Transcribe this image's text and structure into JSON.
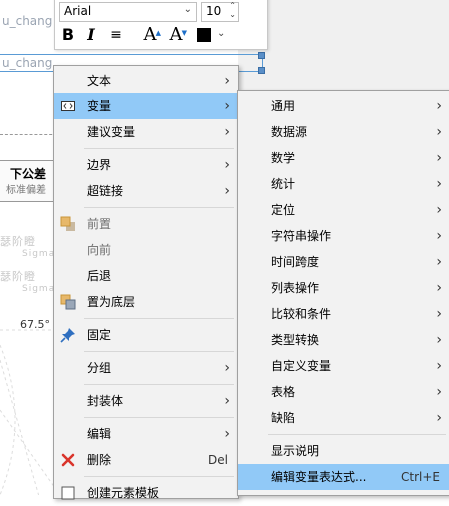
{
  "background": {
    "field_text_top": "u_chang",
    "field_text_mid": "u_chang",
    "header_label": "下公差",
    "sub_label": "标准偏差",
    "ghost_1": "瑟阶瞪",
    "ghost_1b": "Sigma",
    "ghost_2": "瑟阶瞪",
    "ghost_2b": "Sigma",
    "angle_label": "67.5°"
  },
  "toolbar": {
    "font_value": "Arial",
    "size_value": "10",
    "bold": "B",
    "italic": "I",
    "align": "≡",
    "grow": "A",
    "shrink": "A",
    "color_swatch": "#000000"
  },
  "menu": {
    "items": [
      {
        "label": "文本",
        "arrow": "›"
      },
      {
        "label": "变量",
        "arrow": "›"
      },
      {
        "label": "建议变量",
        "arrow": "›"
      },
      {
        "label": "边界",
        "arrow": "›"
      },
      {
        "label": "超链接",
        "arrow": "›"
      },
      {
        "label": "前置"
      },
      {
        "label": "向前"
      },
      {
        "label": "后退"
      },
      {
        "label": "置为底层"
      },
      {
        "label": "固定"
      },
      {
        "label": "分组",
        "arrow": "›"
      },
      {
        "label": "封装体",
        "arrow": "›"
      },
      {
        "label": "编辑",
        "arrow": "›"
      },
      {
        "label": "删除",
        "shortcut": "Del"
      },
      {
        "label": "创建元素模板"
      }
    ]
  },
  "submenu": {
    "items": [
      {
        "label": "通用",
        "arrow": "›"
      },
      {
        "label": "数据源",
        "arrow": "›"
      },
      {
        "label": "数学",
        "arrow": "›"
      },
      {
        "label": "统计",
        "arrow": "›"
      },
      {
        "label": "定位",
        "arrow": "›"
      },
      {
        "label": "字符串操作",
        "arrow": "›"
      },
      {
        "label": "时间跨度",
        "arrow": "›"
      },
      {
        "label": "列表操作",
        "arrow": "›"
      },
      {
        "label": "比较和条件",
        "arrow": "›"
      },
      {
        "label": "类型转换",
        "arrow": "›"
      },
      {
        "label": "自定义变量",
        "arrow": "›"
      },
      {
        "label": "表格",
        "arrow": "›"
      },
      {
        "label": "缺陷",
        "arrow": "›"
      },
      {
        "label": "显示说明"
      },
      {
        "label": "编辑变量表达式...",
        "shortcut": "Ctrl+E"
      }
    ]
  }
}
